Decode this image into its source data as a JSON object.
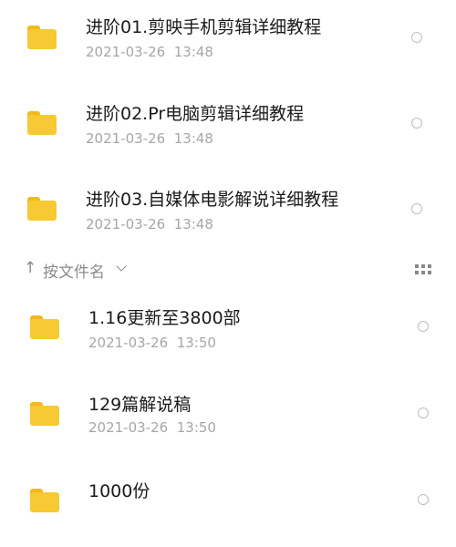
{
  "colors": {
    "folder": "#f7c932",
    "folder_tab": "#f2b81f",
    "date_text": "#a6a6a6",
    "radio_border": "#bdbdbd",
    "sort_text": "#8a8a8a",
    "grid_icon": "#888888"
  },
  "top_files": [
    {
      "name": "进阶01.剪映手机剪辑详细教程",
      "date": "2021-03-26",
      "time": "13:48"
    },
    {
      "name": "进阶02.Pr电脑剪辑详细教程",
      "date": "2021-03-26",
      "time": "13:48"
    },
    {
      "name": "进阶03.自媒体电影解说详细教程",
      "date": "2021-03-26",
      "time": "13:48"
    }
  ],
  "sort": {
    "arrow": "↑",
    "label": "按文件名",
    "chevron_icon": "chevron-down-icon",
    "view_icon": "grid-view-icon"
  },
  "files": [
    {
      "name": "1.16更新至3800部",
      "date": "2021-03-26",
      "time": "13:50"
    },
    {
      "name": "129篇解说稿",
      "date": "2021-03-26",
      "time": "13:50"
    },
    {
      "name": "1000份",
      "date": "",
      "time": ""
    }
  ]
}
